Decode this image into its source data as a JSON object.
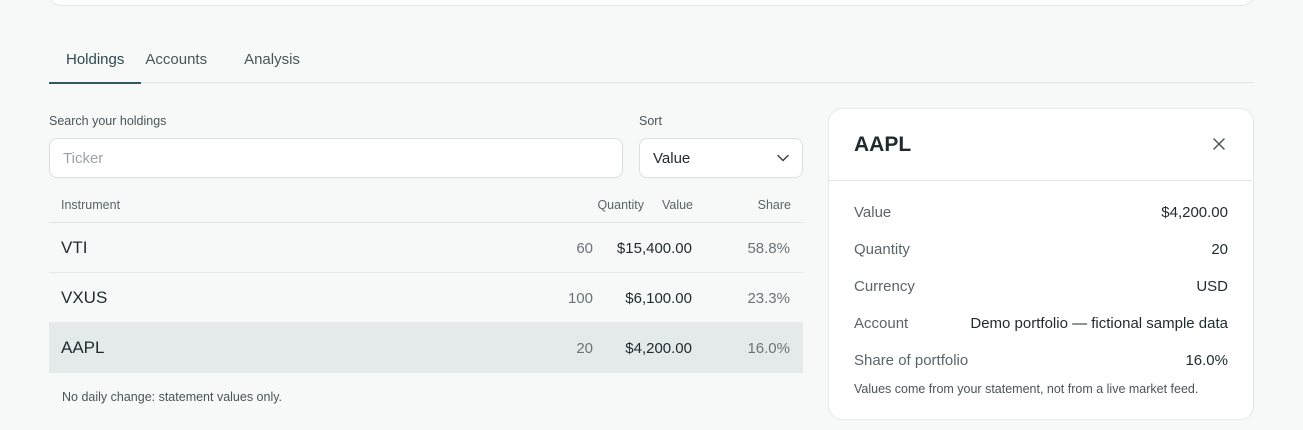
{
  "tabs": [
    {
      "label": "Holdings",
      "active": true
    },
    {
      "label": "Accounts",
      "active": false
    },
    {
      "label": "Analysis",
      "active": false
    }
  ],
  "search": {
    "label": "Search your holdings",
    "placeholder": "Ticker",
    "value": ""
  },
  "sort": {
    "label": "Sort",
    "selected": "Value"
  },
  "table": {
    "headers": {
      "instrument": "Instrument",
      "quantity": "Quantity",
      "value": "Value",
      "share": "Share"
    },
    "rows": [
      {
        "ticker": "VTI",
        "quantity": "60",
        "value": "$15,400.00",
        "share": "58.8%"
      },
      {
        "ticker": "VXUS",
        "quantity": "100",
        "value": "$6,100.00",
        "share": "23.3%"
      },
      {
        "ticker": "AAPL",
        "quantity": "20",
        "value": "$4,200.00",
        "share": "16.0%"
      }
    ],
    "selected_ticker": "AAPL",
    "footnote": "No daily change: statement values only."
  },
  "detail": {
    "title": "AAPL",
    "fields": [
      {
        "label": "Value",
        "value": "$4,200.00"
      },
      {
        "label": "Quantity",
        "value": "20"
      },
      {
        "label": "Currency",
        "value": "USD"
      },
      {
        "label": "Account",
        "value": "Demo portfolio — fictional sample data"
      },
      {
        "label": "Share of portfolio",
        "value": "16.0%"
      }
    ],
    "note": "Values come from your statement, not from a live market feed."
  },
  "colors": {
    "accent": "#35575f",
    "selected_row": "#e4e9e9",
    "background": "#f7f8f8"
  }
}
